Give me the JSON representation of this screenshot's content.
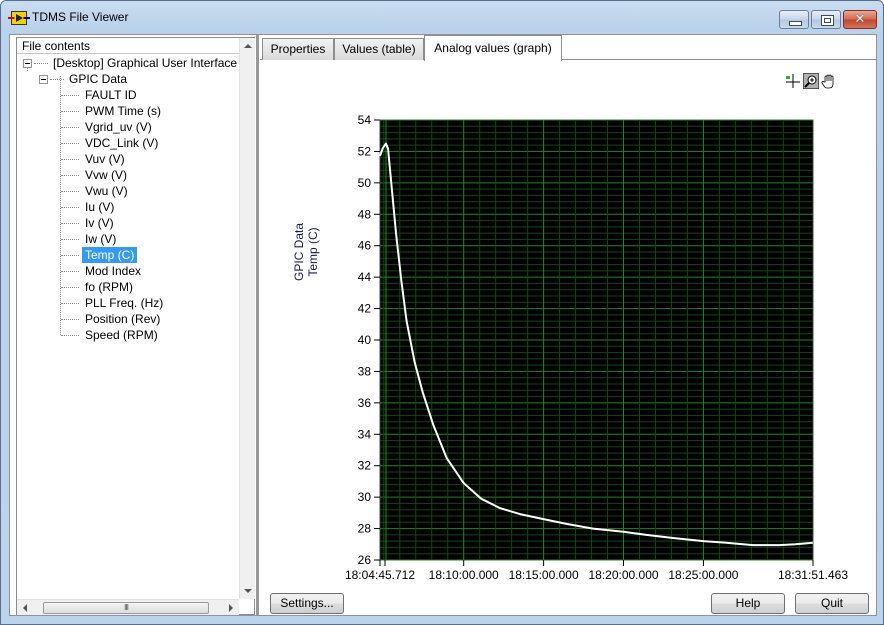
{
  "window": {
    "title": "TDMS File Viewer",
    "controls": {
      "minimize": "minimize",
      "maximize": "maximize",
      "close": "✕"
    }
  },
  "tree": {
    "header": "File contents",
    "root": "[Desktop] Graphical User Interface",
    "group": "GPIC Data",
    "channels": [
      "FAULT ID",
      "PWM Time (s)",
      "Vgrid_uv (V)",
      "VDC_Link (V)",
      "Vuv (V)",
      "Vvw (V)",
      "Vwu (V)",
      "Iu (V)",
      "Iv (V)",
      "Iw (V)",
      "Temp (C)",
      "Mod Index",
      "fo (RPM)",
      "PLL Freq. (Hz)",
      "Position (Rev)",
      "Speed (RPM)"
    ],
    "selected": "Temp (C)",
    "hscroll_grip": "III"
  },
  "tabs": [
    {
      "label": "Properties",
      "active": false
    },
    {
      "label": "Values (table)",
      "active": false
    },
    {
      "label": "Analog values (graph)",
      "active": true
    }
  ],
  "graph_tools": [
    "cursor-tool",
    "zoom-tool",
    "pan-tool"
  ],
  "chart_data": {
    "type": "line",
    "title": "",
    "ylabel_line1": "GPIC Data",
    "ylabel_line2": "Temp (C)",
    "xlabel": "",
    "ylim": [
      26,
      54
    ],
    "yticks": [
      26,
      28,
      30,
      32,
      34,
      36,
      38,
      40,
      42,
      44,
      46,
      48,
      50,
      52,
      54
    ],
    "xlim_seconds": [
      0,
      1625.751
    ],
    "xticks": [
      {
        "t": 0,
        "label": "18:04:45.712"
      },
      {
        "t": 314.288,
        "label": "18:10:00.000"
      },
      {
        "t": 614.288,
        "label": "18:15:00.000"
      },
      {
        "t": 914.288,
        "label": "18:20:00.000"
      },
      {
        "t": 1214.288,
        "label": "18:25:00.000"
      },
      {
        "t": 1625.751,
        "label": "18:31:51.463"
      }
    ],
    "grid": true,
    "colors": {
      "background": "#000000",
      "grid_major": "#1f8a1f",
      "grid_minor": "#0f4a0f",
      "line": "#ffffff"
    },
    "series": [
      {
        "name": "Temp (C)",
        "x_seconds": [
          0,
          10,
          22,
          30,
          45,
          60,
          80,
          100,
          130,
          160,
          200,
          250,
          314,
          380,
          450,
          530,
          614,
          700,
          800,
          914,
          1000,
          1100,
          1214,
          1300,
          1400,
          1500,
          1560,
          1625
        ],
        "values": [
          51.7,
          52.2,
          52.5,
          52.2,
          49.5,
          46.8,
          43.8,
          41.2,
          38.6,
          36.7,
          34.6,
          32.5,
          30.9,
          29.9,
          29.3,
          28.9,
          28.6,
          28.3,
          28.0,
          27.8,
          27.6,
          27.4,
          27.2,
          27.1,
          26.95,
          26.95,
          27.0,
          27.1
        ]
      }
    ]
  },
  "buttons": {
    "settings": "Settings...",
    "help": "Help",
    "quit": "Quit"
  }
}
